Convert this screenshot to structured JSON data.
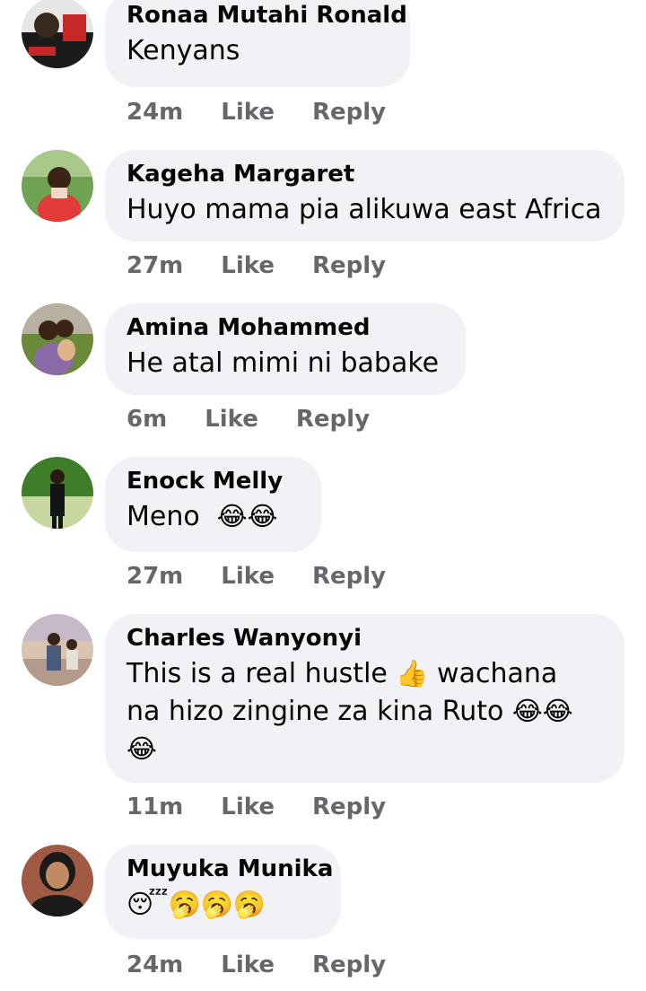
{
  "comments": [
    {
      "author": "Ronaa Mutahi Ronald",
      "text": "Kenyans",
      "time": "24m",
      "like": "Like",
      "reply": "Reply",
      "avatar_colors": [
        "#c62828",
        "#1b1b1b",
        "#e6e6e6"
      ]
    },
    {
      "author": "Kageha Margaret",
      "text": "Huyo mama pia alikuwa east Africa",
      "time": "27m",
      "like": "Like",
      "reply": "Reply",
      "avatar_colors": [
        "#6fa352",
        "#e23a3a",
        "#f3d9c6"
      ]
    },
    {
      "author": "Amina Mohammed",
      "text": "He atal mimi ni babake",
      "time": "6m",
      "like": "Like",
      "reply": "Reply",
      "avatar_colors": [
        "#8a6aa8",
        "#6a8a3a",
        "#e0b48a"
      ]
    },
    {
      "author": "Enock Melly",
      "text": "Meno",
      "emoji": "😂😂",
      "time": "27m",
      "like": "Like",
      "reply": "Reply",
      "avatar_colors": [
        "#3f7d2a",
        "#141414",
        "#e3eec9"
      ]
    },
    {
      "author": "Charles Wanyonyi",
      "text_lines": [
        " This is a real hustle ",
        " wachana",
        "na hizo zingine za kina Ruto "
      ],
      "emoji_thumbs": "👍",
      "emoji_laugh_line2": "😂😂",
      "emoji_laugh_line3": "😂",
      "time": "11m",
      "like": "Like",
      "reply": "Reply",
      "avatar_colors": [
        "#b49a8a",
        "#4a5a7a",
        "#d8c4b0"
      ]
    },
    {
      "author": "Muyuka Munika",
      "emoji": "😴🥱🥱🥱",
      "time": "24m",
      "like": "Like",
      "reply": "Reply",
      "avatar_colors": [
        "#7a1d1d",
        "#1a1a1a",
        "#c08a62"
      ]
    }
  ],
  "colors": {
    "bubble": "#f0f2f5",
    "meta_text": "#65676b",
    "text": "#050505"
  }
}
